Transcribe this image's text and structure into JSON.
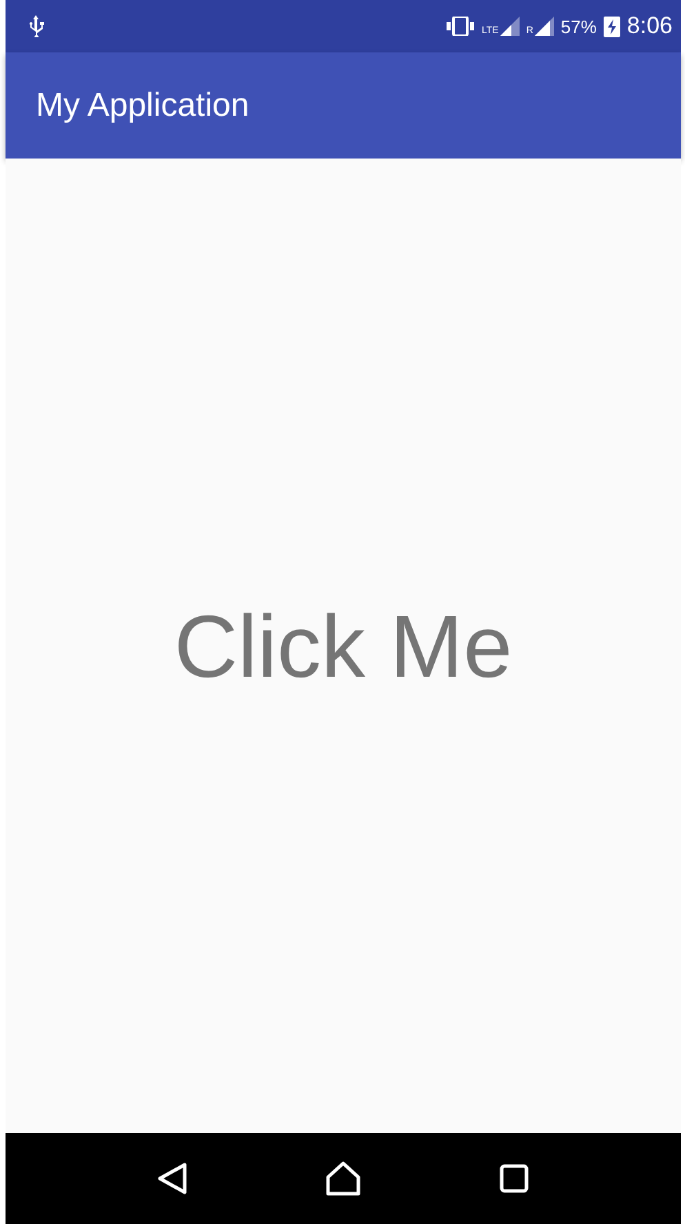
{
  "status_bar": {
    "network_label": "LTE",
    "roaming_label": "R",
    "battery": "57%",
    "time": "8:06"
  },
  "app_bar": {
    "title": "My Application"
  },
  "content": {
    "button": "Click Me"
  }
}
